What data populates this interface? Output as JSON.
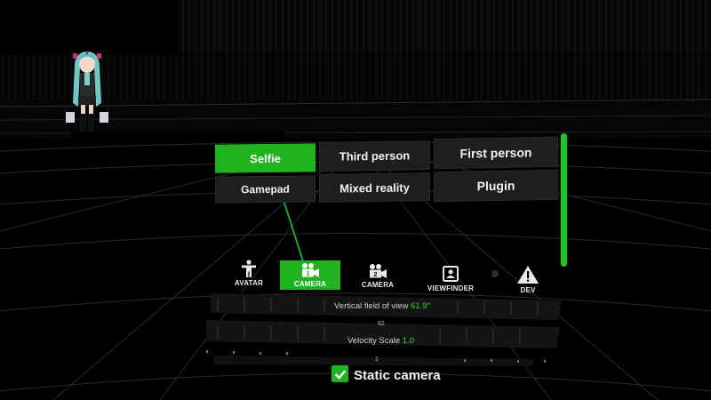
{
  "presets": [
    {
      "label": "Selfie",
      "active": true
    },
    {
      "label": "Third person",
      "active": false
    },
    {
      "label": "First person",
      "active": false
    },
    {
      "label": "Gamepad",
      "active": false
    },
    {
      "label": "Mixed reality",
      "active": false
    },
    {
      "label": "Plugin",
      "active": false
    }
  ],
  "tabs": [
    {
      "label": "AVATAR",
      "icon": "person-icon",
      "active": false
    },
    {
      "label": "CAMERA",
      "icon": "camera-1-icon",
      "badge": "1",
      "active": true
    },
    {
      "label": "CAMERA",
      "icon": "camera-2-icon",
      "badge": "2",
      "active": false
    },
    {
      "label": "VIEWFINDER",
      "icon": "viewfinder-icon",
      "active": false
    },
    {
      "label": "DEV",
      "icon": "warning-icon",
      "active": false
    }
  ],
  "sliders": {
    "fov": {
      "label": "Vertical field of view",
      "value": "61.9°",
      "tick": "62"
    },
    "velocity": {
      "label": "Velocity Scale",
      "value": "1.0",
      "tick": "1"
    }
  },
  "static_camera": {
    "label": "Static camera",
    "checked": true
  },
  "colors": {
    "accent": "#1fb31f",
    "panel": "#1e1e1e",
    "background": "#000000"
  }
}
